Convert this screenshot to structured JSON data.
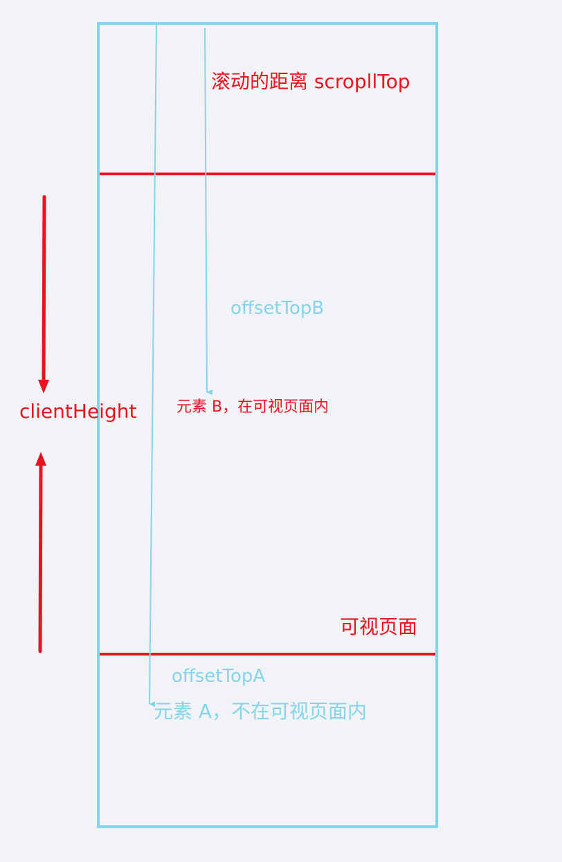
{
  "labels": {
    "scroll_distance": "滚动的距离 scropllTop",
    "offset_top_b": "offsetTopB",
    "element_b": "元素 B，在可视页面内",
    "client_height": "clientHeight",
    "visible_page": "可视页面",
    "offset_top_a": "offsetTopA",
    "element_a": "元素 A，不在可视页面内"
  },
  "colors": {
    "background": "#f1f3f6",
    "frame": "#85d5ea",
    "highlight": "#e8131e"
  }
}
